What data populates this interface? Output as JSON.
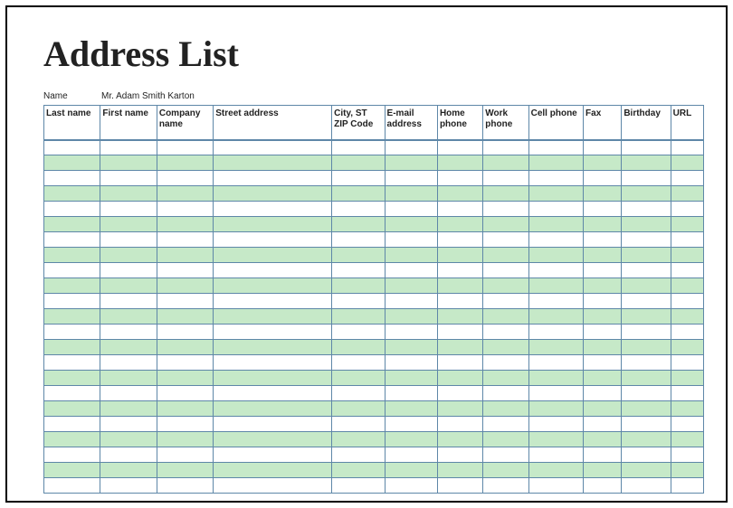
{
  "title": "Address List",
  "name_label": "Name",
  "name_value": "Mr. Adam Smith Karton",
  "columns": [
    "Last name",
    "First name",
    "Company name",
    "Street address",
    "City, ST  ZIP Code",
    "E-mail address",
    "Home phone",
    "Work phone",
    "Cell phone",
    "Fax",
    "Birthday",
    "URL"
  ],
  "row_count": 23,
  "rows": []
}
